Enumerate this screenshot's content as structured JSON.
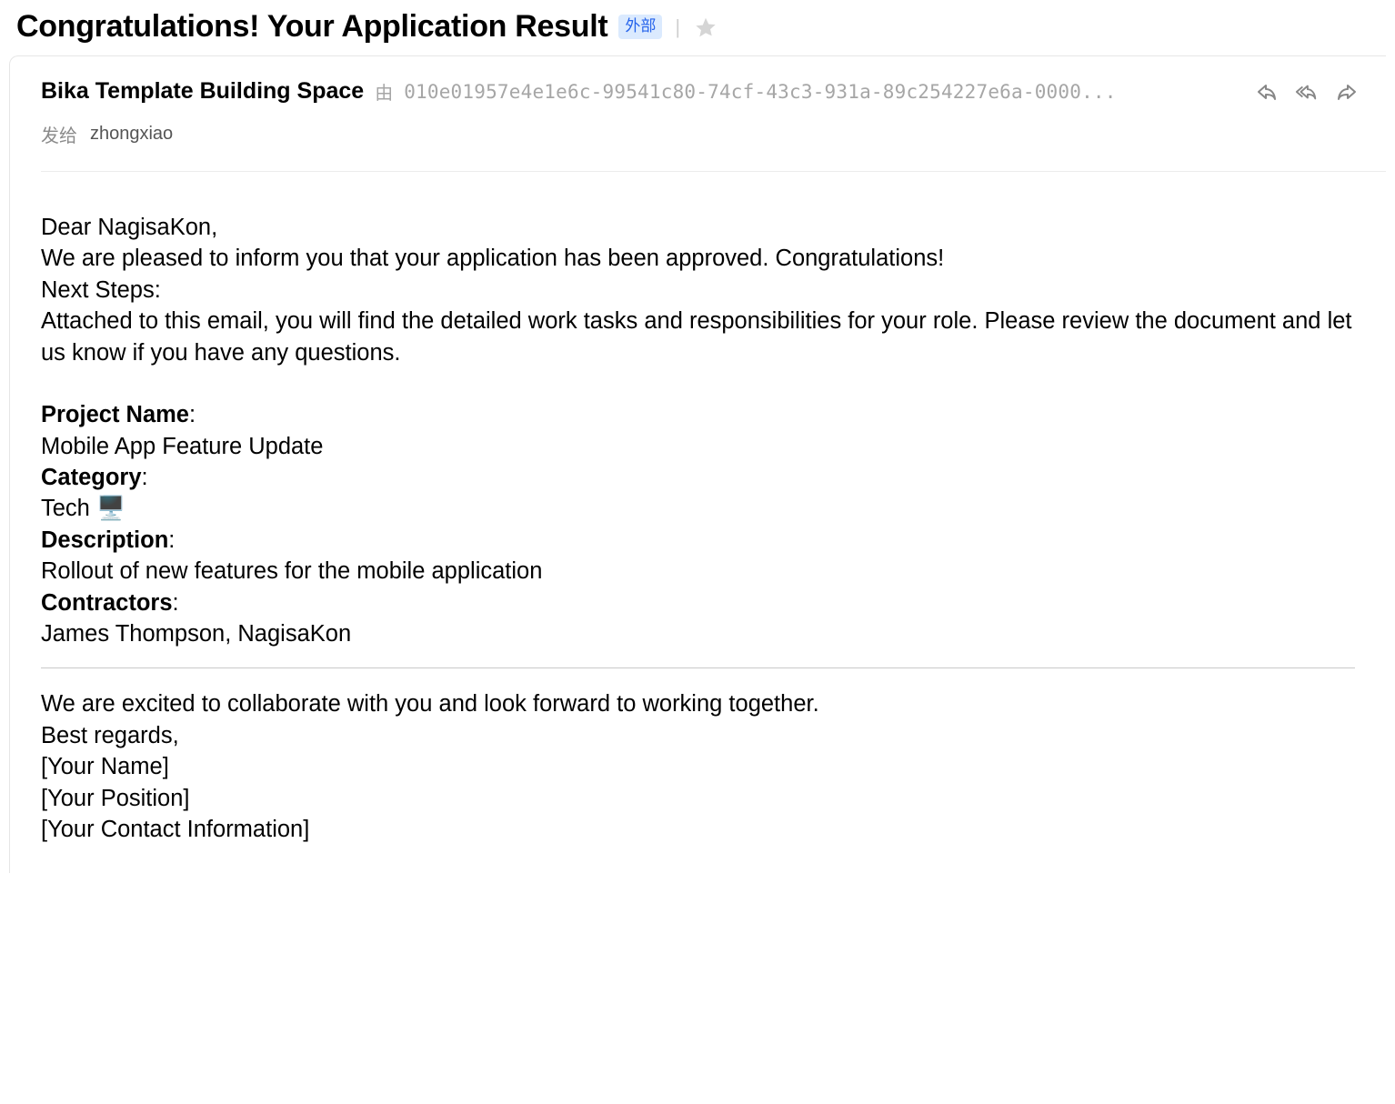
{
  "header": {
    "subject": "Congratulations! Your Application Result",
    "external_tag": "外部"
  },
  "sender": {
    "name": "Bika Template Building Space",
    "via_label": "由",
    "via_id": "010e01957e4e1e6c-99541c80-74cf-43c3-931a-89c254227e6a-0000..."
  },
  "recipient": {
    "label": "发给",
    "name": "zhongxiao"
  },
  "email": {
    "greeting": "Dear NagisaKon,",
    "intro_line1": "We are pleased to inform you that your application has been approved. Congratulations!",
    "intro_line2": "Next Steps:",
    "intro_line3": "Attached to this email, you will find the detailed work tasks and responsibilities for your role. Please review the document and let us know if you have any questions.",
    "project_name_label": "Project Name",
    "project_name_value": "Mobile App Feature Update",
    "category_label": "Category",
    "category_value": "Tech 🖥️",
    "description_label": "Description",
    "description_value": "Rollout of new features for the mobile application",
    "contractors_label": "Contractors",
    "contractors_value": "James Thompson, NagisaKon",
    "closing_line": "We are excited to collaborate with you and look forward to working together.",
    "signoff": "Best regards,",
    "sig_name": "[Your Name]",
    "sig_position": "[Your Position]",
    "sig_contact": "[Your Contact Information]"
  }
}
